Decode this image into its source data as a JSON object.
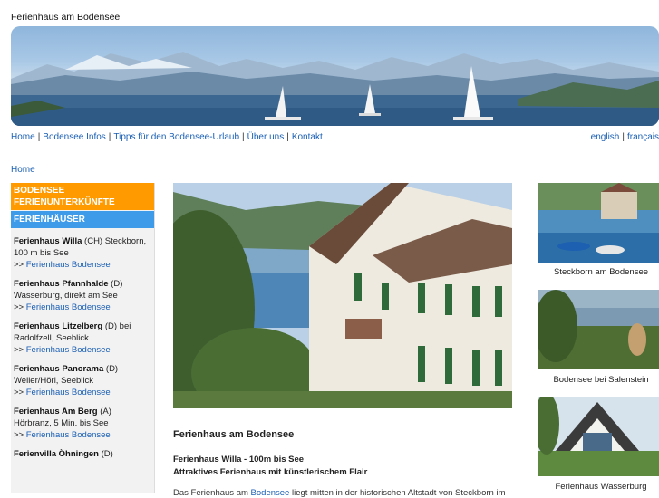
{
  "site": {
    "title": "Ferienhaus am Bodensee"
  },
  "topnav": {
    "items": [
      "Home",
      "Bodensee Infos",
      "Tipps für den Bodensee-Urlaub",
      "Über uns",
      "Kontakt"
    ],
    "sep": "|"
  },
  "langnav": {
    "items": [
      "english",
      "français"
    ],
    "sep": "|"
  },
  "breadcrumb": {
    "home": "Home"
  },
  "sidebar": {
    "header_orange": "Bodensee Ferienunterkünfte",
    "header_blue": "Ferienhäuser",
    "items": [
      {
        "name": "Ferienhaus Willa",
        "desc": " (CH) Steckborn, 100 m bis See",
        "prefix": ">> ",
        "link": "Ferienhaus Bodensee"
      },
      {
        "name": "Ferienhaus Pfannhalde",
        "desc": " (D) Wasserburg, direkt am See",
        "prefix": ">> ",
        "link": "Ferienhaus Bodensee"
      },
      {
        "name": "Ferienhaus Litzelberg",
        "desc": " (D) bei Radolfzell, Seeblick",
        "prefix": ">> ",
        "link": "Ferienhaus Bodensee"
      },
      {
        "name": "Ferienhaus Panorama",
        "desc": " (D) Weiler/Höri, Seeblick",
        "prefix": ">> ",
        "link": "Ferienhaus Bodensee"
      },
      {
        "name": "Ferienhaus Am Berg",
        "desc": " (A) Hörbranz, 5 Min. bis See",
        "prefix": ">> ",
        "link": "Ferienhaus Bodensee"
      },
      {
        "name": "Ferienvilla Öhningen",
        "desc": " (D)",
        "prefix": "",
        "link": ""
      }
    ]
  },
  "main": {
    "title": "Ferienhaus am Bodensee",
    "subtitle_1": "Ferienhaus Willa - 100m bis See",
    "subtitle_2": "Attraktives Ferienhaus mit künstlerischem Flair",
    "text_before": "Das Ferienhaus am ",
    "text_link": "Bodensee",
    "text_after": " liegt mitten in der historischen Altstadt von Steckborn im"
  },
  "thumbs": [
    {
      "caption": "Steckborn am Bodensee"
    },
    {
      "caption": "Bodensee bei Salenstein"
    },
    {
      "caption": "Ferienhaus Wasserburg"
    }
  ]
}
